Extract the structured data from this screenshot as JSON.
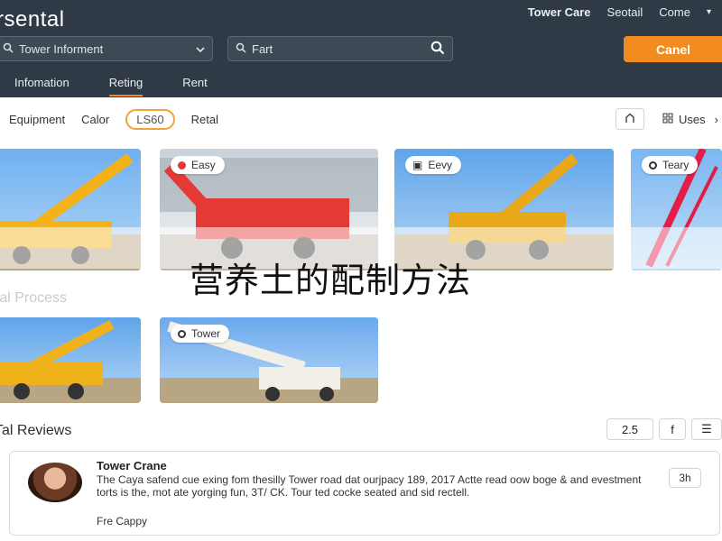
{
  "header": {
    "brand": "rsental",
    "top_links": [
      "Tower Care",
      "Seotail",
      "Come"
    ],
    "select_value": "Tower Informent",
    "search_value": "Fart",
    "cta_label": "Canel",
    "tabs": [
      "Infomation",
      "Reting",
      "Rent"
    ],
    "active_tab": "Reting"
  },
  "filters": {
    "items": [
      "Equipment",
      "Calor",
      "LS60",
      "Retal"
    ],
    "selected": "LS60",
    "uses_label": "Uses"
  },
  "cards": [
    {
      "tag": "",
      "colors": {
        "boom": "#f3b21a",
        "body": "#f3b21a"
      }
    },
    {
      "tag": "Easy",
      "colors": {
        "boom": "#e53935",
        "body": "#e53935"
      }
    },
    {
      "tag": "Eevy",
      "colors": {
        "boom": "#e9a818",
        "body": "#e9a818"
      }
    },
    {
      "tag": "Teary",
      "colors": {
        "boom": "#e21d48",
        "body": "#e21d48"
      }
    }
  ],
  "cards_row2": [
    {
      "tag": "",
      "colors": {
        "boom": "#f0b21a"
      }
    },
    {
      "tag": "Tower",
      "colors": {
        "boom": "#f2f0e6"
      }
    }
  ],
  "overlay_title": "营养土的配制方法",
  "sections": {
    "process": "ral Process",
    "reviews": "Tal Reviews"
  },
  "review_tools": {
    "count": "2.5",
    "share": "f"
  },
  "review": {
    "name": "Tower Crane",
    "body": "The Caya safend cue exing fom thesilly Tower road dat ourjpacy 189, 2017 Actte read oow boge & and evestment torts is the, mot ate yorging fun, 3T/ CK. Tour ted cocke seated and sid rectell.",
    "footer": "Fre Cappy",
    "badge": "3h"
  },
  "accent": "#f28c1e"
}
